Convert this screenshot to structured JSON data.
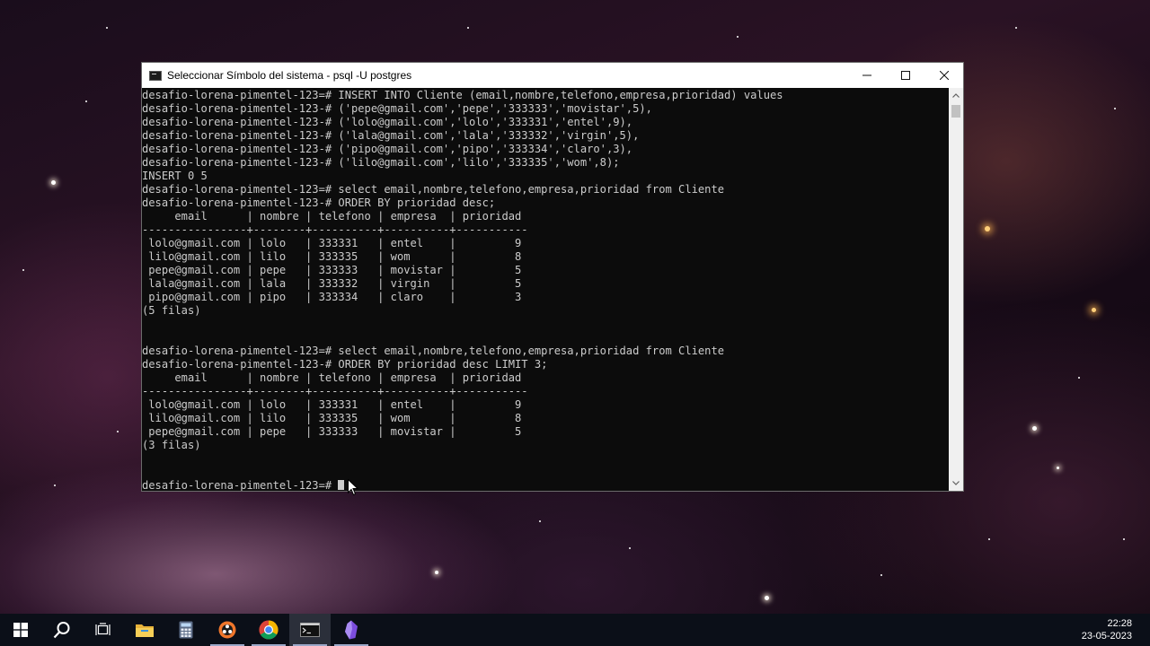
{
  "window": {
    "title": "Seleccionar Símbolo del sistema - psql  -U postgres",
    "minimize_icon": "minimize-icon",
    "maximize_icon": "maximize-icon",
    "close_icon": "close-icon"
  },
  "console": {
    "lines": [
      "desafio-lorena-pimentel-123=# INSERT INTO Cliente (email,nombre,telefono,empresa,prioridad) values",
      "desafio-lorena-pimentel-123-# ('pepe@gmail.com','pepe','333333','movistar',5),",
      "desafio-lorena-pimentel-123-# ('lolo@gmail.com','lolo','333331','entel',9),",
      "desafio-lorena-pimentel-123-# ('lala@gmail.com','lala','333332','virgin',5),",
      "desafio-lorena-pimentel-123-# ('pipo@gmail.com','pipo','333334','claro',3),",
      "desafio-lorena-pimentel-123-# ('lilo@gmail.com','lilo','333335','wom',8);",
      "INSERT 0 5",
      "desafio-lorena-pimentel-123=# select email,nombre,telefono,empresa,prioridad from Cliente",
      "desafio-lorena-pimentel-123-# ORDER BY prioridad desc;",
      "     email      | nombre | telefono | empresa  | prioridad",
      "----------------+--------+----------+----------+-----------",
      " lolo@gmail.com | lolo   | 333331   | entel    |         9",
      " lilo@gmail.com | lilo   | 333335   | wom      |         8",
      " pepe@gmail.com | pepe   | 333333   | movistar |         5",
      " lala@gmail.com | lala   | 333332   | virgin   |         5",
      " pipo@gmail.com | pipo   | 333334   | claro    |         3",
      "(5 filas)",
      "",
      "",
      "desafio-lorena-pimentel-123=# select email,nombre,telefono,empresa,prioridad from Cliente",
      "desafio-lorena-pimentel-123-# ORDER BY prioridad desc LIMIT 3;",
      "     email      | nombre | telefono | empresa  | prioridad",
      "----------------+--------+----------+----------+-----------",
      " lolo@gmail.com | lolo   | 333331   | entel    |         9",
      " lilo@gmail.com | lilo   | 333335   | wom      |         8",
      " pepe@gmail.com | pepe   | 333333   | movistar |         5",
      "(3 filas)",
      "",
      ""
    ],
    "prompt": "desafio-lorena-pimentel-123=# "
  },
  "taskbar": {
    "items": [
      {
        "icon": "windows-start-icon",
        "running": false,
        "active": false
      },
      {
        "icon": "search-icon",
        "running": false,
        "active": false
      },
      {
        "icon": "task-view-icon",
        "running": false,
        "active": false
      },
      {
        "icon": "file-explorer-icon",
        "running": false,
        "active": false
      },
      {
        "icon": "calculator-icon",
        "running": false,
        "active": false
      },
      {
        "icon": "obs-icon",
        "running": true,
        "active": false
      },
      {
        "icon": "chrome-icon",
        "running": true,
        "active": false
      },
      {
        "icon": "command-prompt-icon",
        "running": true,
        "active": true
      },
      {
        "icon": "obsidian-icon",
        "running": true,
        "active": false
      }
    ],
    "clock": {
      "time": "22:28",
      "date": "23-05-2023"
    }
  },
  "colors": {
    "console_bg": "#0c0c0c",
    "console_fg": "#cccccc",
    "taskbar_bg": "#0b0f18"
  }
}
